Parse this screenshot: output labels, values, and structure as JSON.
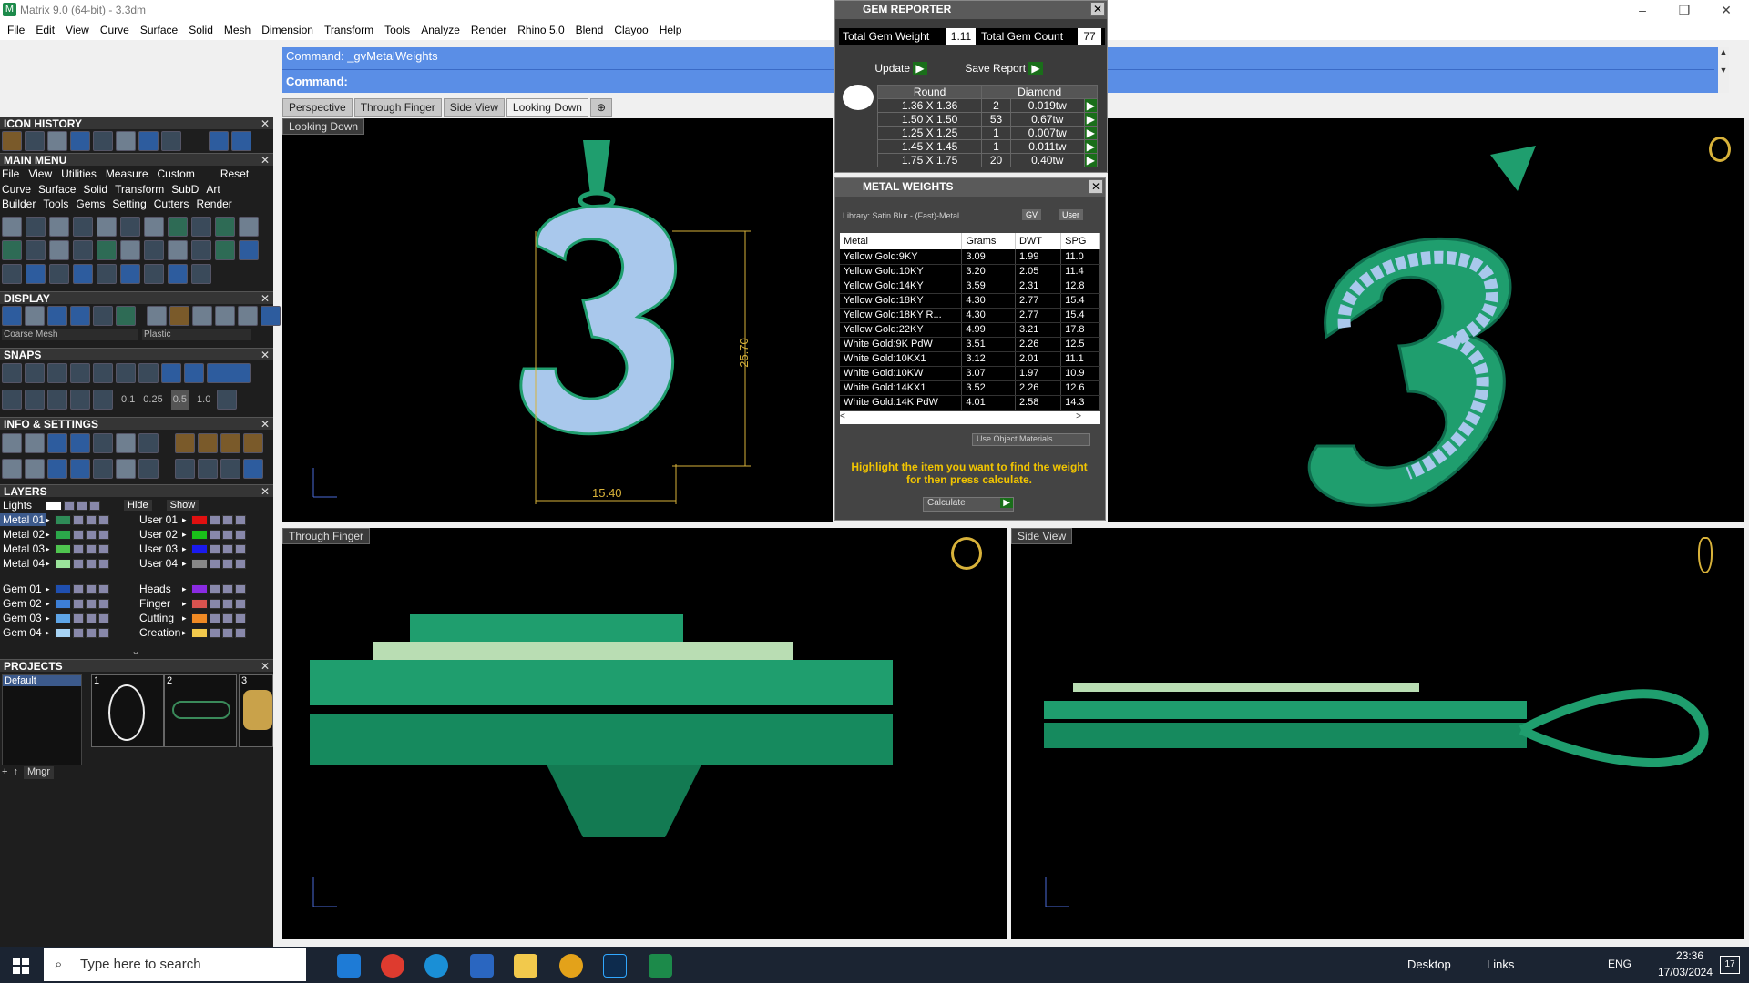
{
  "window": {
    "title": "Matrix 9.0 (64-bit) - 3.3dm"
  },
  "menubar": [
    "File",
    "Edit",
    "View",
    "Curve",
    "Surface",
    "Solid",
    "Mesh",
    "Dimension",
    "Transform",
    "Tools",
    "Analyze",
    "Render",
    "Rhino 5.0",
    "Blend",
    "Clayoo",
    "Help"
  ],
  "command": {
    "line1": "Command: _gvMetalWeights",
    "line2": "Command:"
  },
  "viewport_tabs": [
    "Perspective",
    "Through Finger",
    "Side View",
    "Looking Down"
  ],
  "left": {
    "icon_history": "ICON HISTORY",
    "main_menu": "MAIN MENU",
    "main_menu_items": [
      "File",
      "View",
      "Utilities",
      "Measure",
      "Custom",
      "Reset"
    ],
    "main_menu_row2": [
      "Curve",
      "Surface",
      "Solid",
      "Transform",
      "SubD",
      "Art"
    ],
    "main_menu_row3": [
      "Builder",
      "Tools",
      "Gems",
      "Setting",
      "Cutters",
      "Render"
    ],
    "display": "DISPLAY",
    "display_mesh": "Coarse Mesh",
    "display_material": "Plastic",
    "snaps": "SNAPS",
    "snap_values": [
      "0.1",
      "0.25",
      "0.5",
      "1.0"
    ],
    "info_settings": "INFO & SETTINGS",
    "layers": "LAYERS",
    "lights": "Lights",
    "hide": "Hide",
    "show": "Show",
    "layer_left": [
      "Metal 01",
      "Metal 02",
      "Metal 03",
      "Metal 04",
      "Gem 01",
      "Gem 02",
      "Gem 03",
      "Gem 04"
    ],
    "layer_left_colors": [
      "#2e8b57",
      "#2ba84a",
      "#4fc44f",
      "#9be39b",
      "#1f4fb0",
      "#3d7fd6",
      "#5fa6e8",
      "#a8d4f5"
    ],
    "layer_right": [
      "User 01",
      "User 02",
      "User 03",
      "User 04",
      "Heads",
      "Finger",
      "Cutting",
      "Creation"
    ],
    "layer_right_colors": [
      "#e01010",
      "#19c219",
      "#1a1aee",
      "#888888",
      "#8a2be2",
      "#d9534f",
      "#f08a24",
      "#f2c94c"
    ],
    "projects": "PROJECTS",
    "project_default": "Default",
    "project_nums": [
      "1",
      "2",
      "3"
    ],
    "mngr": "Mngr"
  },
  "viewports": {
    "looking_down": "Looking Down",
    "through_finger": "Through Finger",
    "side_view": "Side View",
    "dim_width": "15.40",
    "dim_height": "25.70"
  },
  "gem_reporter": {
    "title": "GEM REPORTER",
    "total_weight_label": "Total Gem Weight",
    "total_weight": "1.11",
    "total_count_label": "Total Gem Count",
    "total_count": "77",
    "update": "Update",
    "save_report": "Save Report",
    "headers": [
      "Round",
      "Diamond"
    ],
    "rows": [
      [
        "1.36 X 1.36",
        "2",
        "0.019tw"
      ],
      [
        "1.50 X 1.50",
        "53",
        "0.67tw"
      ],
      [
        "1.25 X 1.25",
        "1",
        "0.007tw"
      ],
      [
        "1.45 X 1.45",
        "1",
        "0.011tw"
      ],
      [
        "1.75 X 1.75",
        "20",
        "0.40tw"
      ]
    ]
  },
  "metal_weights": {
    "title": "METAL WEIGHTS",
    "library": "Library: Satin Blur - (Fast)-Metal",
    "gv": "GV",
    "user": "User",
    "headers": [
      "Metal",
      "Grams",
      "DWT",
      "SPG"
    ],
    "rows": [
      [
        "Yellow Gold:9KY",
        "3.09",
        "1.99",
        "11.0"
      ],
      [
        "Yellow Gold:10KY",
        "3.20",
        "2.05",
        "11.4"
      ],
      [
        "Yellow Gold:14KY",
        "3.59",
        "2.31",
        "12.8"
      ],
      [
        "Yellow Gold:18KY",
        "4.30",
        "2.77",
        "15.4"
      ],
      [
        "Yellow Gold:18KY R...",
        "4.30",
        "2.77",
        "15.4"
      ],
      [
        "Yellow Gold:22KY",
        "4.99",
        "3.21",
        "17.8"
      ],
      [
        "White Gold:9K PdW",
        "3.51",
        "2.26",
        "12.5"
      ],
      [
        "White Gold:10KX1",
        "3.12",
        "2.01",
        "11.1"
      ],
      [
        "White Gold:10KW",
        "3.07",
        "1.97",
        "10.9"
      ],
      [
        "White Gold:14KX1",
        "3.52",
        "2.26",
        "12.6"
      ],
      [
        "White Gold:14K PdW",
        "4.01",
        "2.58",
        "14.3"
      ]
    ],
    "use_object_materials": "Use Object Materials",
    "hint": "Highlight the item you want to find the weight for then press calculate.",
    "calculate": "Calculate"
  },
  "taskbar": {
    "search": "Type here to search",
    "desktop": "Desktop",
    "links": "Links",
    "lang": "ENG",
    "time": "23:36",
    "date": "17/03/2024",
    "notif": "17"
  },
  "colors": {
    "accent": "#5a8ee6",
    "metal": "#2aa876",
    "gem": "#1d3f9e",
    "pearl": "#a9c8ec"
  }
}
